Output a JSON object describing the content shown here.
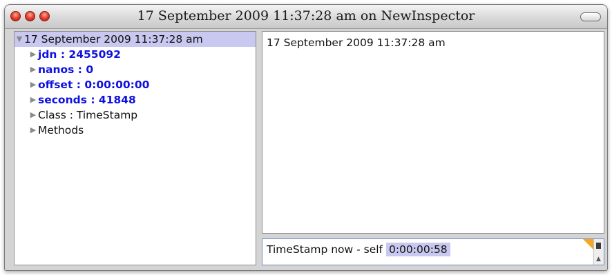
{
  "window": {
    "title": "17 September 2009 11:37:28 am on NewInspector"
  },
  "tree": {
    "root": "17 September 2009 11:37:28 am",
    "items": [
      {
        "label": "jdn : 2455092",
        "emphasis": true
      },
      {
        "label": "nanos : 0",
        "emphasis": true
      },
      {
        "label": "offset : 0:00:00:00",
        "emphasis": true
      },
      {
        "label": "seconds : 41848",
        "emphasis": true
      },
      {
        "label": "Class : TimeStamp",
        "emphasis": false
      },
      {
        "label": "Methods",
        "emphasis": false
      }
    ]
  },
  "value_pane": {
    "text": "17 September 2009 11:37:28 am"
  },
  "eval_pane": {
    "expression": "TimeStamp now - self",
    "result": "0:00:00:58"
  },
  "icons": {
    "expanded": "triangle-down-icon",
    "collapsed": "triangle-right-icon",
    "close": "close-button-icon",
    "minimize": "minimize-button-icon",
    "zoom": "zoom-button-icon",
    "toolbar": "toolbar-toggle-icon",
    "scroll_up": "scroll-up-icon"
  },
  "colors": {
    "selection": "#c8c8f0",
    "emphasis_text": "#1010e0",
    "traffic_red": "#e8442f",
    "corner_accent": "#f5a623"
  }
}
